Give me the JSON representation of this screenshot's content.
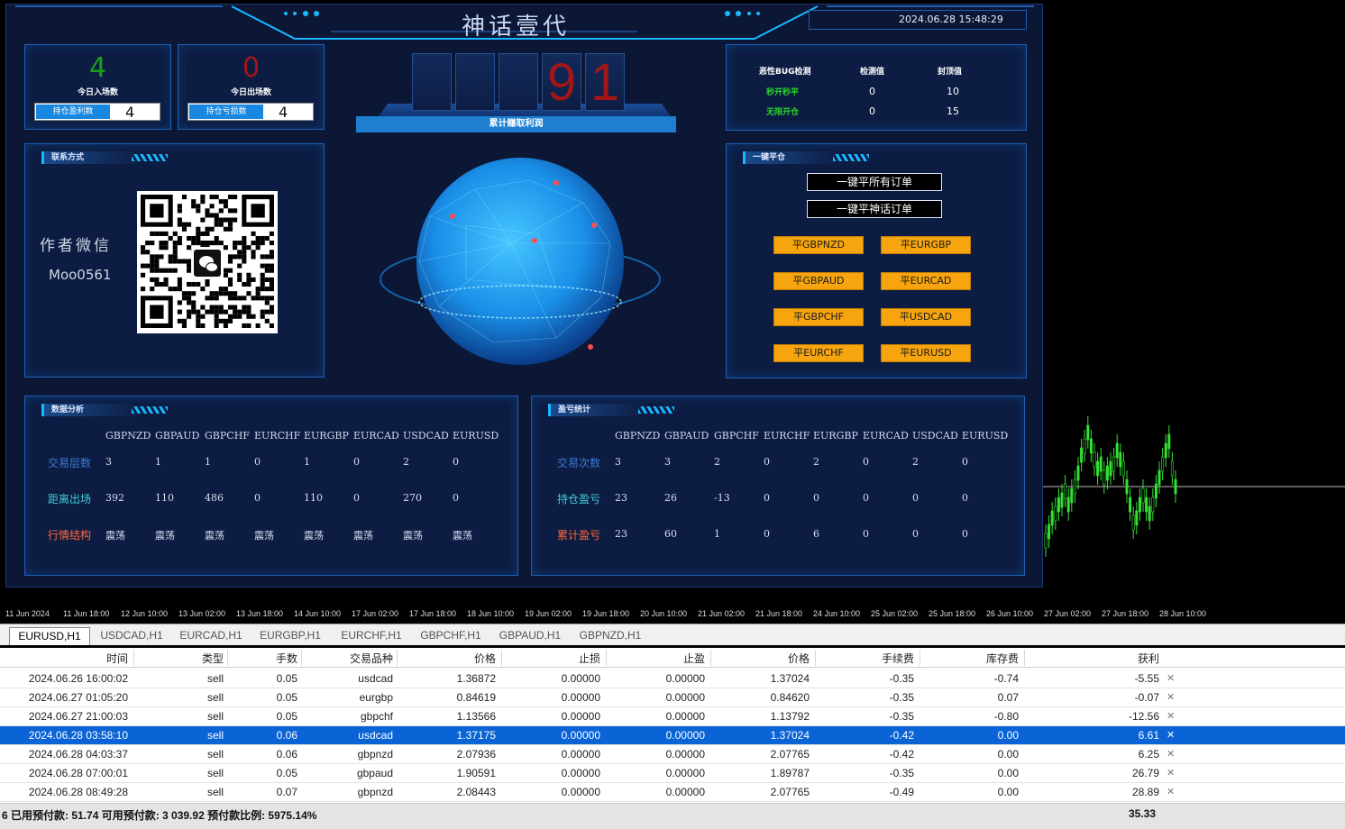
{
  "header": {
    "title": "神话壹代",
    "datetime": "2024.06.28 15:48:29"
  },
  "entries": {
    "today_in_value": "4",
    "today_in_label": "今日入场数",
    "holding_profit_label": "持仓盈利数",
    "holding_profit_value": "4"
  },
  "exits": {
    "today_out_value": "0",
    "today_out_label": "今日出场数",
    "holding_loss_label": "持仓亏损数",
    "holding_loss_value": "4"
  },
  "profit_counter": {
    "digits": [
      "",
      "",
      "",
      "9",
      "1"
    ],
    "label": "累计赚取利润"
  },
  "bug_check": {
    "col1": "恶性BUG检测",
    "col2": "检测值",
    "col3": "封顶值",
    "rows": [
      {
        "name": "秒开秒平",
        "value": "0",
        "cap": "10"
      },
      {
        "name": "无限开仓",
        "value": "0",
        "cap": "15"
      }
    ]
  },
  "contact": {
    "title": "联系方式",
    "wechat_label": "作者微信",
    "wechat_id": "Moo0561"
  },
  "close_panel": {
    "title": "一键平仓",
    "close_all": "一键平所有订单",
    "close_myth": "一键平神话订单",
    "pairs": [
      "平GBPNZD",
      "平EURGBP",
      "平GBPAUD",
      "平EURCAD",
      "平GBPCHF",
      "平USDCAD",
      "平EURCHF",
      "平EURUSD"
    ]
  },
  "analysis": {
    "title": "数据分析",
    "symbols": [
      "GBPNZD",
      "GBPAUD",
      "GBPCHF",
      "EURCHF",
      "EURGBP",
      "EURCAD",
      "USDCAD",
      "EURUSD"
    ],
    "rows": [
      {
        "label": "交易层数",
        "values": [
          "3",
          "1",
          "1",
          "0",
          "1",
          "0",
          "2",
          "0"
        ]
      },
      {
        "label": "距离出场",
        "values": [
          "392",
          "110",
          "486",
          "0",
          "110",
          "0",
          "270",
          "0"
        ]
      },
      {
        "label": "行情结构",
        "values": [
          "震荡",
          "震荡",
          "震荡",
          "震荡",
          "震荡",
          "震荡",
          "震荡",
          "震荡"
        ]
      }
    ]
  },
  "pnl": {
    "title": "盈亏统计",
    "symbols": [
      "GBPNZD",
      "GBPAUD",
      "GBPCHF",
      "EURCHF",
      "EURGBP",
      "EURCAD",
      "USDCAD",
      "EURUSD"
    ],
    "rows": [
      {
        "label": "交易次数",
        "values": [
          "3",
          "3",
          "2",
          "0",
          "2",
          "0",
          "2",
          "0"
        ]
      },
      {
        "label": "持仓盈亏",
        "values": [
          "23",
          "26",
          "-13",
          "0",
          "0",
          "0",
          "0",
          "0"
        ]
      },
      {
        "label": "累计盈亏",
        "values": [
          "23",
          "60",
          "1",
          "0",
          "6",
          "0",
          "0",
          "0"
        ]
      }
    ]
  },
  "xaxis": [
    "11 Jun 2024",
    "11 Jun 18:00",
    "12 Jun 10:00",
    "13 Jun 02:00",
    "13 Jun 18:00",
    "14 Jun 10:00",
    "17 Jun 02:00",
    "17 Jun 18:00",
    "18 Jun 10:00",
    "19 Jun 02:00",
    "19 Jun 18:00",
    "20 Jun 10:00",
    "21 Jun 02:00",
    "21 Jun 18:00",
    "24 Jun 10:00",
    "25 Jun 02:00",
    "25 Jun 18:00",
    "26 Jun 10:00",
    "27 Jun 02:00",
    "27 Jun 18:00",
    "28 Jun 10:00"
  ],
  "tabs": [
    "EURUSD,H1",
    "USDCAD,H1",
    "EURCAD,H1",
    "EURGBP,H1",
    "EURCHF,H1",
    "GBPCHF,H1",
    "GBPAUD,H1",
    "GBPNZD,H1"
  ],
  "orders": {
    "columns": [
      "时间",
      "类型",
      "手数",
      "交易品种",
      "价格",
      "止损",
      "止盈",
      "价格",
      "手续费",
      "库存费",
      "获利"
    ],
    "rows": [
      [
        "2024.06.26 16:00:02",
        "sell",
        "0.05",
        "usdcad",
        "1.36872",
        "0.00000",
        "0.00000",
        "1.37024",
        "-0.35",
        "-0.74",
        "-5.55"
      ],
      [
        "2024.06.27 01:05:20",
        "sell",
        "0.05",
        "eurgbp",
        "0.84619",
        "0.00000",
        "0.00000",
        "0.84620",
        "-0.35",
        "0.07",
        "-0.07"
      ],
      [
        "2024.06.27 21:00:03",
        "sell",
        "0.05",
        "gbpchf",
        "1.13566",
        "0.00000",
        "0.00000",
        "1.13792",
        "-0.35",
        "-0.80",
        "-12.56"
      ],
      [
        "2024.06.28 03:58:10",
        "sell",
        "0.06",
        "usdcad",
        "1.37175",
        "0.00000",
        "0.00000",
        "1.37024",
        "-0.42",
        "0.00",
        "6.61"
      ],
      [
        "2024.06.28 04:03:37",
        "sell",
        "0.06",
        "gbpnzd",
        "2.07936",
        "0.00000",
        "0.00000",
        "2.07765",
        "-0.42",
        "0.00",
        "6.25"
      ],
      [
        "2024.06.28 07:00:01",
        "sell",
        "0.05",
        "gbpaud",
        "1.90591",
        "0.00000",
        "0.00000",
        "1.89787",
        "-0.35",
        "0.00",
        "26.79"
      ],
      [
        "2024.06.28 08:49:28",
        "sell",
        "0.07",
        "gbpnzd",
        "2.08443",
        "0.00000",
        "0.00000",
        "2.07765",
        "-0.49",
        "0.00",
        "28.89"
      ]
    ],
    "selected_index": 3
  },
  "status": {
    "text": "6  已用预付款: 51.74  可用预付款: 3 039.92  预付款比例: 5975.14%",
    "total": "35.33"
  },
  "colors": {
    "panel_border": "#1f5fb3",
    "accent": "#19b8ff",
    "orange": "#f7a50e",
    "selected_row": "#0a64d6"
  }
}
